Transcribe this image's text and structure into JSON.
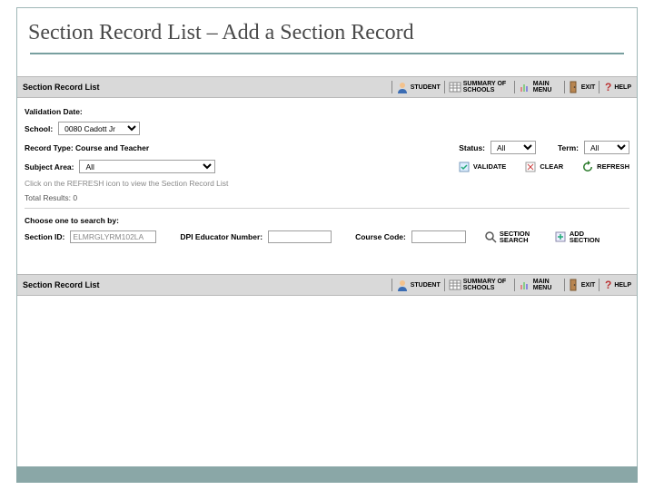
{
  "slide": {
    "title": "Section Record List – Add a Section Record"
  },
  "header": {
    "title": "Section Record List",
    "toolbar": {
      "student": "STUDENT",
      "summary": "SUMMARY OF SCHOOLS",
      "main_menu": "MAIN MENU",
      "exit": "EXIT",
      "help": "HELP"
    }
  },
  "filters": {
    "validation_date_label": "Validation Date:",
    "school_label": "School:",
    "school_value": "0080 Cadott Jr",
    "record_type_label": "Record Type: Course and Teacher",
    "status_label": "Status:",
    "status_value": "All",
    "term_label": "Term:",
    "term_value": "All",
    "subject_area_label": "Subject Area:",
    "subject_area_value": "All",
    "validate_btn": "VALIDATE",
    "clear_btn": "CLEAR",
    "refresh_btn": "REFRESH",
    "hint": "Click on the REFRESH icon to view the Section Record List",
    "total_results_label": "Total Results: 0"
  },
  "search": {
    "heading": "Choose one to search by:",
    "section_id_label": "Section ID:",
    "section_id_value": "ELMRGLYRM102LA",
    "dpi_educator_label": "DPI Educator Number:",
    "course_code_label": "Course Code:",
    "section_search_btn": "SECTION SEARCH",
    "add_section_btn": "ADD SECTION"
  }
}
